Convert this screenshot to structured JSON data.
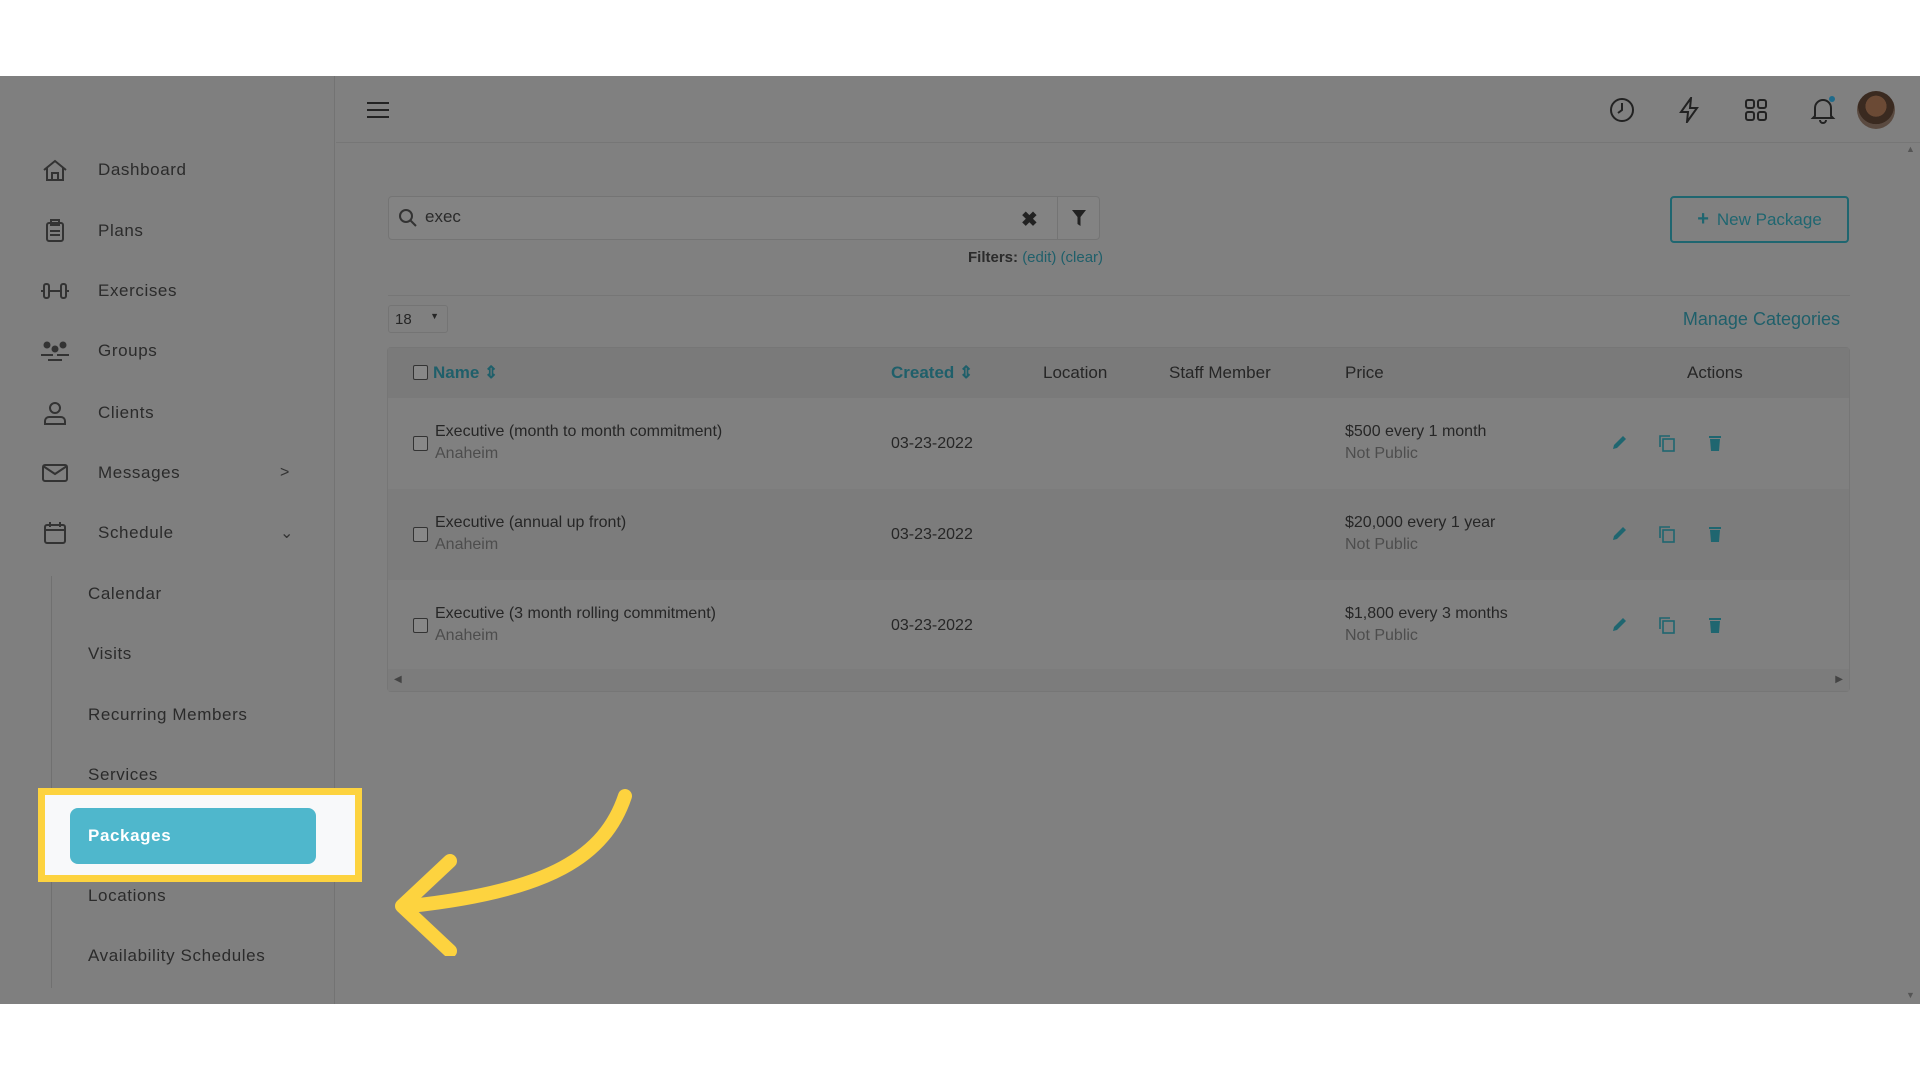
{
  "sidebar": {
    "items": [
      {
        "label": "Dashboard",
        "icon": "home-icon"
      },
      {
        "label": "Plans",
        "icon": "clipboard-icon"
      },
      {
        "label": "Exercises",
        "icon": "dumbbell-icon"
      },
      {
        "label": "Groups",
        "icon": "groups-icon"
      },
      {
        "label": "Clients",
        "icon": "user-icon"
      },
      {
        "label": "Messages",
        "icon": "envelope-icon"
      },
      {
        "label": "Schedule",
        "icon": "calendar-icon"
      }
    ],
    "schedule_sub": [
      "Calendar",
      "Visits",
      "Recurring Members",
      "Services",
      "Packages",
      "Locations",
      "Availability Schedules"
    ],
    "active": "Packages"
  },
  "search": {
    "value": "exec"
  },
  "filters": {
    "label": "Filters:",
    "edit": "(edit)",
    "clear": "(clear)"
  },
  "new_package": "New Package",
  "page_size": "18",
  "manage_categories": "Manage Categories",
  "table": {
    "headers": {
      "name": "Name",
      "created": "Created",
      "location": "Location",
      "staff": "Staff Member",
      "price": "Price",
      "actions": "Actions"
    },
    "rows": [
      {
        "name": "Executive (month to month commitment)",
        "location": "Anaheim",
        "created": "03-23-2022",
        "price": "$500 every 1 month",
        "visibility": "Not Public"
      },
      {
        "name": "Executive (annual up front)",
        "location": "Anaheim",
        "created": "03-23-2022",
        "price": "$20,000 every 1 year",
        "visibility": "Not Public"
      },
      {
        "name": "Executive (3 month rolling commitment)",
        "location": "Anaheim",
        "created": "03-23-2022",
        "price": "$1,800 every 3 months",
        "visibility": "Not Public"
      }
    ]
  },
  "colors": {
    "accent": "#1f6670",
    "highlight": "#fdd33f",
    "active_item": "#4fb7cc",
    "overlay": "#808080"
  }
}
